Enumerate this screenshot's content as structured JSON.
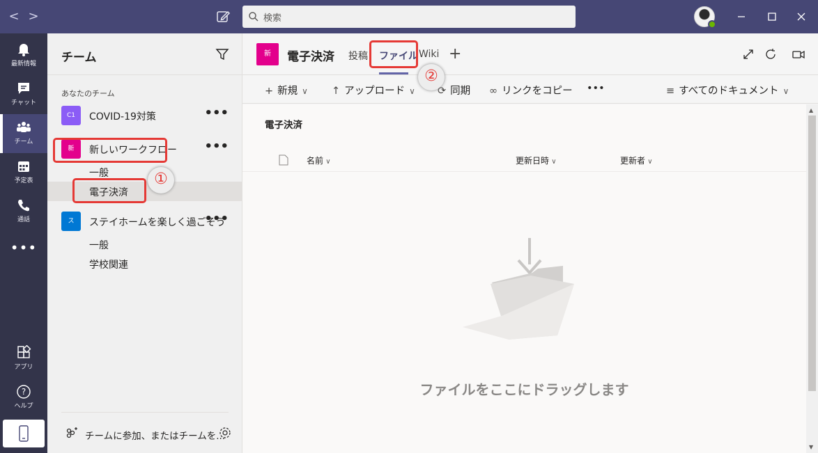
{
  "titlebar": {
    "back_label": "<",
    "forward_label": ">",
    "search_placeholder": "検索"
  },
  "rail": {
    "items": [
      {
        "label": "最新情報",
        "icon": "bell-icon"
      },
      {
        "label": "チャット",
        "icon": "chat-icon"
      },
      {
        "label": "チーム",
        "icon": "teams-icon"
      },
      {
        "label": "予定表",
        "icon": "calendar-icon"
      },
      {
        "label": "通話",
        "icon": "phone-icon"
      }
    ],
    "more_label": "•••",
    "bottom_items": [
      {
        "label": "アプリ",
        "icon": "apps-icon"
      },
      {
        "label": "ヘルプ",
        "icon": "help-icon"
      }
    ]
  },
  "teams_panel": {
    "title": "チーム",
    "section_label": "あなたのチーム",
    "teams": [
      {
        "tile": "C1",
        "name": "COVID-19対策",
        "color": "#8b5cf6",
        "channels": []
      },
      {
        "tile": "新",
        "name": "新しいワークフロー",
        "color": "#e3008c",
        "channels": [
          "一般",
          "電子決済"
        ]
      },
      {
        "tile": "ス",
        "name": "ステイホームを楽しく過ごそう",
        "color": "#0078d4",
        "channels": [
          "一般",
          "学校関連"
        ]
      }
    ],
    "more_label": "•••",
    "footer_label": "チームに参加、またはチームを..."
  },
  "annotations": {
    "callout_1": "①",
    "callout_2": "②"
  },
  "channel_header": {
    "tile": "新",
    "title": "電子決済",
    "tabs": [
      "投稿",
      "ファイル",
      "Wiki"
    ],
    "plus_label": "+"
  },
  "toolbar": {
    "new_label": "新規",
    "upload_label": "アップロード",
    "sync_label": "同期",
    "copy_link_label": "リンクをコピー",
    "more_label": "•••",
    "view_label": "すべてのドキュメント"
  },
  "document_library": {
    "title": "電子決済",
    "columns": [
      "名前",
      "更新日時",
      "更新者"
    ],
    "empty_message": "ファイルをここにドラッグします"
  }
}
